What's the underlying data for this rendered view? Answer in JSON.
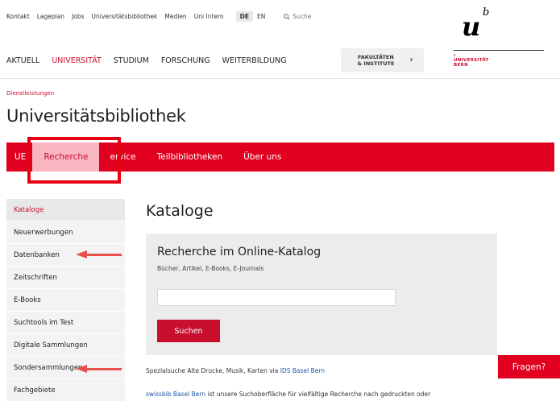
{
  "top_bar": {
    "links": [
      "Kontakt",
      "Lageplan",
      "Jobs",
      "Universitätsbibliothek",
      "Medien",
      "Uni Intern"
    ],
    "languages": [
      "DE",
      "EN"
    ],
    "active_language": "DE",
    "search_placeholder": "Suche"
  },
  "logo": {
    "ub": "u",
    "b": "b",
    "small": "b",
    "name_line1": "UNIVERSITÄT",
    "name_line2": "BERN"
  },
  "main_nav": {
    "items": [
      "AKTUELL",
      "UNIVERSITÄT",
      "STUDIUM",
      "FORSCHUNG",
      "WEITERBILDUNG"
    ],
    "active": "UNIVERSITÄT",
    "faculties_line1": "FAKULTÄTEN",
    "faculties_line2": "& INSTITUTE"
  },
  "breadcrumb": "Dienstleistungen",
  "page_title": "Universitätsbibliothek",
  "sub_nav": {
    "items": [
      "UB",
      "Recherche",
      "Service",
      "Teilbibliotheken",
      "Über uns"
    ],
    "visible_labels": [
      "UE",
      "Recherche",
      "ervice",
      "Teilbibliotheken",
      "Über uns"
    ],
    "active": "Recherche"
  },
  "sidebar": {
    "items": [
      "Kataloge",
      "Neuerwerbungen",
      "Datenbanken",
      "Zeitschriften",
      "E-Books",
      "Suchtools im Test",
      "Digitale Sammlungen",
      "Sondersammlungen",
      "Fachgebiete"
    ],
    "active": "Kataloge"
  },
  "content": {
    "title": "Kataloge",
    "panel_title": "Recherche im Online-Katalog",
    "panel_subtitle": "Bücher, Artikel, E-Books, E-Journals",
    "search_value": "",
    "search_button": "Suchen",
    "special_search_text": "Spezialsuche Alte Drucke, Musik, Karten via ",
    "special_search_link": "IDS Basel Bern",
    "swissbib_link": "swissbib Basel Bern",
    "swissbib_text": " ist unsere Suchoberfläche für vielfältige Recherche nach gedruckten oder"
  },
  "help_button": "Fragen?",
  "colors": {
    "brand_red": "#e1001f",
    "active_tab_bg": "#f9b6c1",
    "annotation_red": "#e60012",
    "arrow_red": "#e8504a",
    "link_blue": "#1e5aa8"
  }
}
